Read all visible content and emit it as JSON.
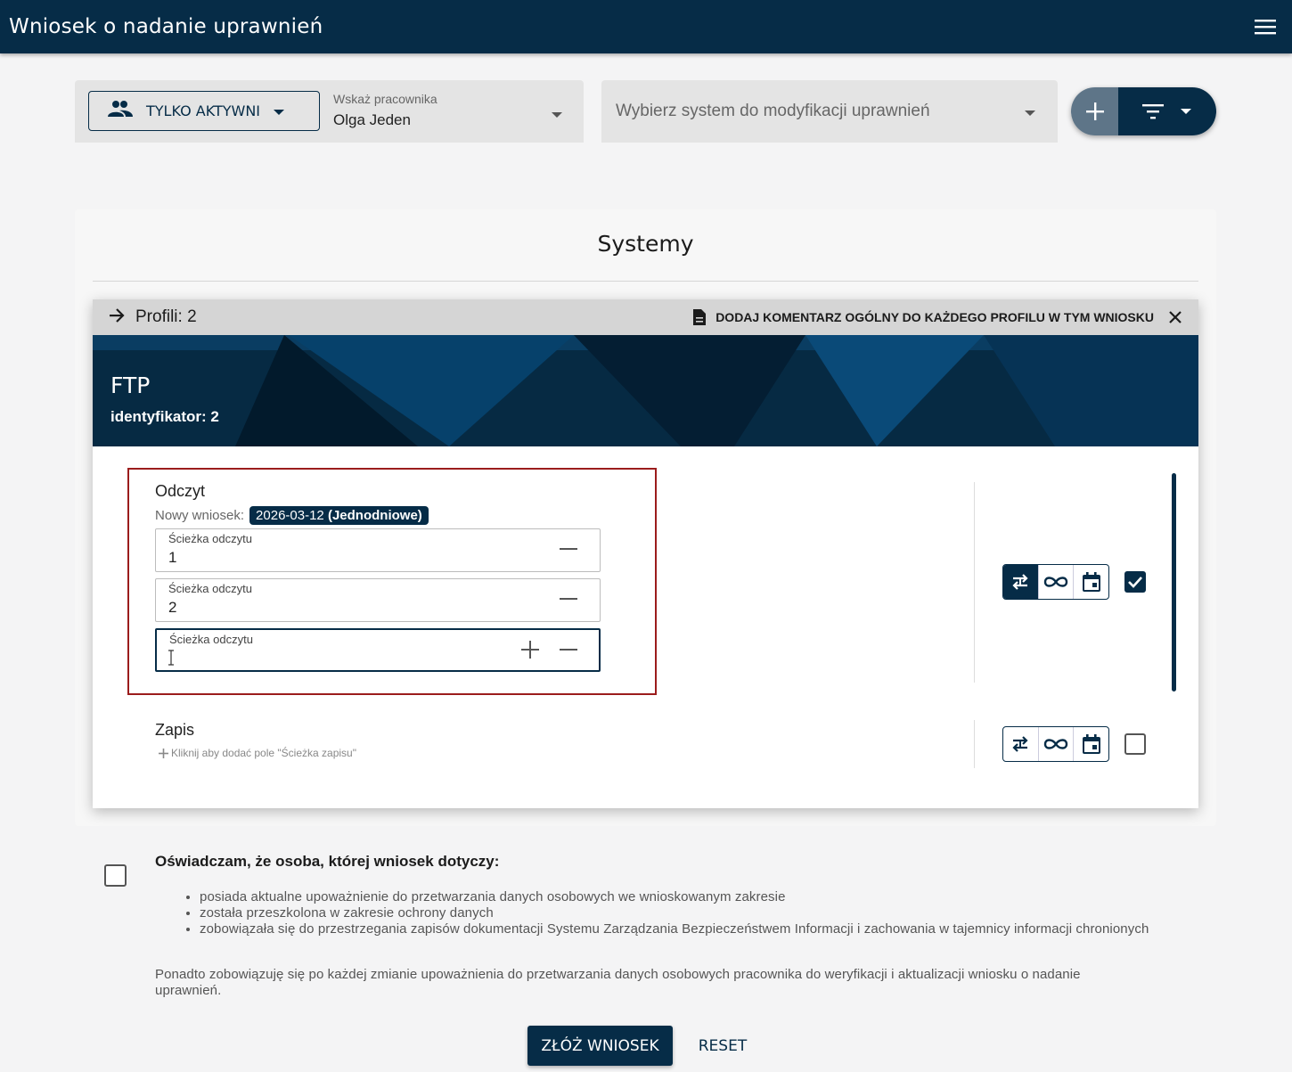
{
  "appbar": {
    "title": "Wniosek o nadanie uprawnień",
    "menu_icon": "menu-icon"
  },
  "filters": {
    "active_label": "TYLKO AKTYWNI",
    "employee_label": "Wskaż pracownika",
    "employee_value": "Olga Jeden",
    "system_placeholder": "Wybierz system do modyfikacji uprawnień"
  },
  "systems": {
    "title": "Systemy",
    "profiles_label": "Profili: 2",
    "comment_button": "DODAJ KOMENTARZ OGÓLNY DO KAŻDEGO PROFILU W TYM WNIOSKU",
    "system_name": "FTP",
    "system_id": "identyfikator: 2",
    "permissions": [
      {
        "name": "Odczyt",
        "new_request_label": "Nowy wniosek:",
        "chip_date": "2026-03-12",
        "chip_type": "(Jednodniowe)",
        "fields": [
          {
            "label": "Ścieżka odczytu",
            "value": "1"
          },
          {
            "label": "Ścieżka odczytu",
            "value": "2"
          },
          {
            "label": "Ścieżka odczytu",
            "value": ""
          }
        ],
        "checked": true
      },
      {
        "name": "Zapis",
        "add_hint": "Kliknij aby dodać pole \"Ścieżka zapisu\"",
        "checked": false
      }
    ]
  },
  "declaration": {
    "title": "Oświadczam, że osoba, której wniosek dotyczy:",
    "items": [
      "posiada aktualne upoważnienie do przetwarzania danych osobowych we wnioskowanym zakresie",
      "została przeszkolona w zakresie ochrony danych",
      "zobowiązała się do przestrzegania zapisów dokumentacji Systemu Zarządzania Bezpieczeństwem Informacji i zachowania w tajemnicy informacji chronionych"
    ],
    "extra": "Ponadto zobowiązuję się po każdej zmianie upoważnienia do przetwarzania danych osobowych pracownika do weryfikacji i aktualizacji wniosku o nadanie uprawnień."
  },
  "actions": {
    "submit": "ZŁÓŻ WNIOSEK",
    "reset": "RESET"
  },
  "colors": {
    "primary": "#062c47",
    "highlight_border": "#9b1c1c"
  }
}
